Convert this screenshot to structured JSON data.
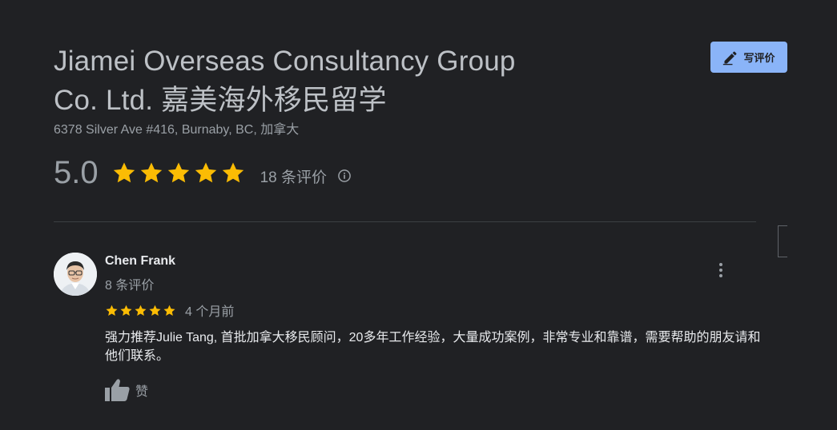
{
  "business": {
    "name_line1": "Jiamei Overseas Consultancy Group",
    "name_line2": "Co. Ltd. 嘉美海外移民留学",
    "address": "6378 Silver Ave #416, Burnaby, BC, 加拿大",
    "rating": "5.0",
    "stars": 5,
    "review_count": "18 条评价"
  },
  "write_review_button": {
    "label": "写评价"
  },
  "colors": {
    "background": "#202124",
    "star": "#fbbc04",
    "button": "#8ab4f8",
    "divider": "#3c4043"
  },
  "reviews": [
    {
      "author": "Chen Frank",
      "author_meta": "8 条评价",
      "stars": 5,
      "time": "4 个月前",
      "text": "强力推荐Julie Tang, 首批加拿大移民顾问，20多年工作经验，大量成功案例，非常专业和靠谱，需要帮助的朋友请和他们联系。",
      "like_label": "赞"
    }
  ],
  "icons": {
    "write": "pencil-icon",
    "info": "info-icon",
    "more": "more-vert-icon",
    "like": "thumb-up-icon",
    "star": "star-icon"
  }
}
